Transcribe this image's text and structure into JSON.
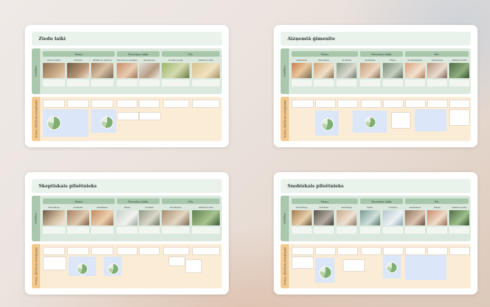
{
  "boards": [
    {
      "title": "Ziedu laiki",
      "lane_top_label": "Darbības",
      "lane_bottom_label": "Domas, šķēršļi un atvieglojumi",
      "phases": [
        "Pirms",
        "Pieredzes laikā",
        "Pēc"
      ],
      "steps": [
        {
          "label": "Ziedu kultūra",
          "photo": "food-photo"
        },
        {
          "label": "Dzērieni",
          "photo": "drink-photo"
        },
        {
          "label": "Maltīte un dzērieni",
          "photo": "meal-photo"
        },
        {
          "label": "Pieredzes novērtējums",
          "photo": "dish-photo"
        },
        {
          "label": "Atsauksmes",
          "photo": "plate-photo"
        },
        {
          "label": "Sociālie mediji",
          "photo": "jar-photo"
        },
        {
          "label": "Atkārtota vizīte",
          "photo": "shop-photo"
        }
      ]
    },
    {
      "title": "Aizņemtā ģimenīte",
      "lane_top_label": "Darbības",
      "lane_bottom_label": "Domas, šķēršļi un atvieglojumi",
      "phases": [
        "Pirms",
        "Pieredzes laikā",
        "Pēc"
      ],
      "steps": [
        {
          "label": "Meklēšana",
          "photo": "family-photo"
        },
        {
          "label": "Ēdienkarte",
          "photo": "burger-photo"
        },
        {
          "label": "Ierašanās",
          "photo": "hand-photo"
        },
        {
          "label": "Pasūtīšana",
          "photo": "order-photo"
        },
        {
          "label": "Ēšana",
          "photo": "eat-photo"
        },
        {
          "label": "Norēķināšanās",
          "photo": "pay-photo"
        },
        {
          "label": "Atsauksmes",
          "photo": "review-photo"
        },
        {
          "label": "Atkārtota vizīte",
          "photo": "park-photo"
        }
      ]
    },
    {
      "title": "Skeptiskais pilsētnieks",
      "lane_top_label": "Darbības",
      "lane_bottom_label": "Domas, šķēršļi un atvieglojumi",
      "phases": [
        "Pirms",
        "Pieredzes laikā",
        "Pēc"
      ],
      "steps": [
        {
          "label": "Informācija",
          "photo": "coffee-photo"
        },
        {
          "label": "Ierašanās",
          "photo": "table-photo"
        },
        {
          "label": "Pasūtīšana",
          "photo": "bread-photo"
        },
        {
          "label": "Ēšana",
          "photo": "glass-photo"
        },
        {
          "label": "Norēķini",
          "photo": "dinner-photo"
        },
        {
          "label": "Atsauksmes",
          "photo": "salad-photo"
        },
        {
          "label": "Atkārtota vizīte",
          "photo": "garden-photo"
        }
      ]
    },
    {
      "title": "Snobiskais pilsētnieks",
      "lane_top_label": "Darbības",
      "lane_bottom_label": "Domas, šķēršļi un atvieglojumi",
      "phases": [
        "Pirms",
        "Pieredzes laikā",
        "Pēc"
      ],
      "steps": [
        {
          "label": "Informācija",
          "photo": "dish-photo"
        },
        {
          "label": "Ierašanās",
          "photo": "interior-photo"
        },
        {
          "label": "Pasūtīšana",
          "photo": "wine-photo"
        },
        {
          "label": "Ēšana",
          "photo": "glass-photo"
        },
        {
          "label": "Norēķini",
          "photo": "water-photo"
        },
        {
          "label": "Atsauksmes",
          "photo": "dinner-photo"
        },
        {
          "label": "Ēdiens",
          "photo": "plate-photo"
        },
        {
          "label": "Atkārtota vizīte",
          "photo": "garden-photo"
        }
      ]
    }
  ]
}
